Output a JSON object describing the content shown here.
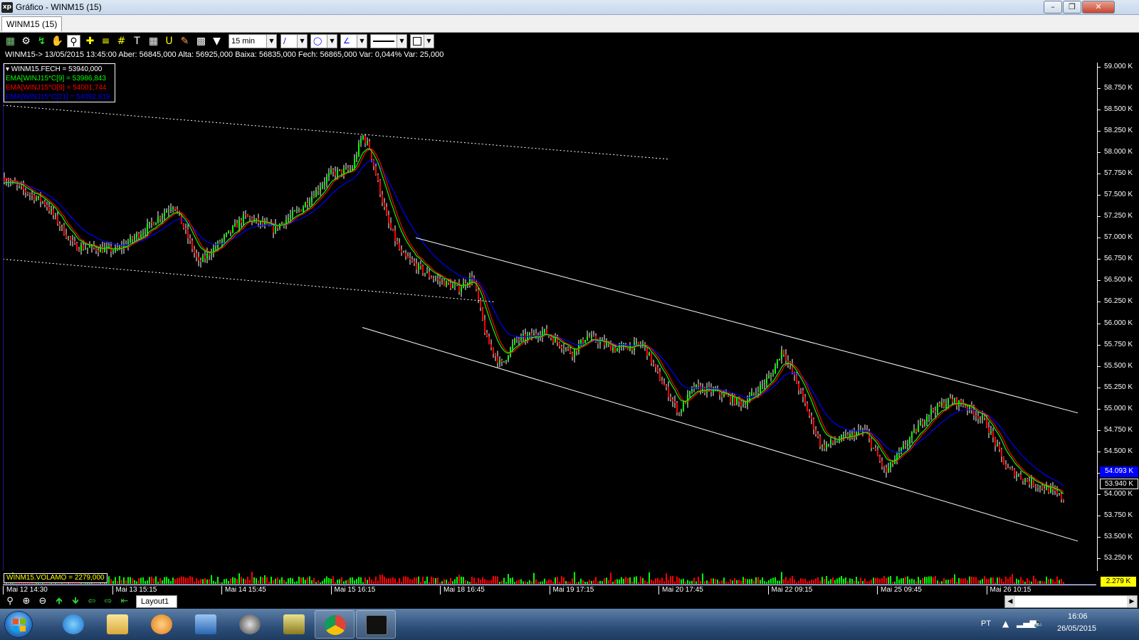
{
  "window": {
    "title": "Gráfico - WINM15 (15)",
    "app_icon_text": "xp",
    "minimize_icon": "minimize-icon",
    "maximize_icon": "maximize-icon",
    "close_icon": "close-icon"
  },
  "tabs": [
    {
      "label": "WINM15 (15)",
      "active": true
    }
  ],
  "toolbar": {
    "timeframe": "15 min",
    "icons": [
      "chart-type-icon",
      "gear-icon",
      "indicator-icon",
      "hand-icon",
      "zoom-area-icon",
      "crosshair-icon",
      "horizontal-line-icon",
      "grid-icon",
      "text-icon",
      "calculator-icon",
      "magnet-icon",
      "pen-icon",
      "save-icon",
      "filter-icon"
    ],
    "line_tool_icon": "trend-line-icon",
    "ellipse_tool_icon": "ellipse-icon",
    "fib_tool_icon": "fibonacci-fan-icon",
    "line_style_icon": "line-style-icon",
    "color_picker_icon": "color-picker-icon"
  },
  "info_line": "WINM15-> 13/05/2015 13:45:00 Aber: 56845,000 Alta: 56925,000 Baixa: 56835,000 Fech: 56865,000 Var: 0,044% Var: 25,000",
  "legend": [
    {
      "text": "WINM15.FECH = 53940,000",
      "color": "#ffffff",
      "marker": "▾ "
    },
    {
      "text": "EMA[WINJ15*C[9] = 53986,843",
      "color": "#00ff00",
      "marker": ""
    },
    {
      "text": "EMA[WINJ15*O[9] = 54001,744",
      "color": "#ff0000",
      "marker": ""
    },
    {
      "text": "EMA[WINJ15*C[21] = 54092,619",
      "color": "#0000ff",
      "marker": ""
    }
  ],
  "price_axis": {
    "ticks": [
      "59.000 K",
      "58.750 K",
      "58.500 K",
      "58.250 K",
      "58.000 K",
      "57.750 K",
      "57.500 K",
      "57.250 K",
      "57.000 K",
      "56.750 K",
      "56.500 K",
      "56.250 K",
      "56.000 K",
      "55.750 K",
      "55.500 K",
      "55.250 K",
      "55.000 K",
      "54.750 K",
      "54.500 K",
      "54.250 K",
      "54.000 K",
      "53.750 K",
      "53.500 K",
      "53.250 K"
    ],
    "last_ema21": "54.093 K",
    "last_close": "53.940 K"
  },
  "volume": {
    "label": "WINM15.VOLAMO = 2279,000",
    "value": "2.279 K"
  },
  "time_axis": [
    "Mai 12 14:30",
    "Mai 13 15:15",
    "Mai 14 15:45",
    "Mai 15 16:15",
    "Mai 18 16:45",
    "Mai 19 17:15",
    "Mai 20 17:45",
    "Mai 22 09:15",
    "Mai 25 09:45",
    "Mai 26 10:15"
  ],
  "bottom_bar": {
    "icons": [
      "zoom-icon",
      "zoom-in-icon",
      "zoom-out-icon",
      "arrow-up-icon",
      "arrow-down-icon",
      "arrow-left-icon",
      "arrow-right-icon",
      "arrow-end-left-icon"
    ],
    "layout_tab": "Layout1",
    "scroll_left_icon": "scroll-left-icon",
    "scroll_right_icon": "scroll-right-icon"
  },
  "taskbar": {
    "start_icon": "windows-start-icon",
    "apps": [
      "internet-explorer-icon",
      "file-explorer-icon",
      "media-player-icon",
      "outlook-icon",
      "hp-icon",
      "transfer-icon",
      "chrome-icon",
      "xp-investimentos-icon"
    ],
    "language": "PT",
    "time": "16:06",
    "date": "26/05/2015",
    "tray_icons": [
      "tray-arrow-icon",
      "network-icon",
      "volume-icon"
    ]
  },
  "colors": {
    "up_candle": "#00ff00",
    "down_candle": "#ff0000",
    "ema_close_9": "#00ff00",
    "ema_open_9": "#ff0000",
    "ema_close_21": "#0000ff",
    "channel_lines": "#ffffff",
    "background": "#000000"
  },
  "chart_data": {
    "type": "candlestick",
    "title": "",
    "ylim": [
      53100,
      59050
    ],
    "y_unit": "points",
    "x_categories": [
      "Mai 12 14:30",
      "Mai 13 15:15",
      "Mai 14 15:45",
      "Mai 15 16:15",
      "Mai 18 16:45",
      "Mai 19 17:15",
      "Mai 20 17:45",
      "Mai 22 09:15",
      "Mai 25 09:45",
      "Mai 26 10:15"
    ],
    "close_path_estimate": [
      [
        0,
        57700
      ],
      [
        60,
        57400
      ],
      [
        100,
        56900
      ],
      [
        160,
        56850
      ],
      [
        200,
        57100
      ],
      [
        240,
        57400
      ],
      [
        275,
        56700
      ],
      [
        300,
        56900
      ],
      [
        340,
        57250
      ],
      [
        380,
        57100
      ],
      [
        420,
        57350
      ],
      [
        460,
        57750
      ],
      [
        490,
        57800
      ],
      [
        505,
        58200
      ],
      [
        515,
        58050
      ],
      [
        540,
        57200
      ],
      [
        560,
        56800
      ],
      [
        600,
        56550
      ],
      [
        640,
        56400
      ],
      [
        660,
        56550
      ],
      [
        680,
        55800
      ],
      [
        700,
        55500
      ],
      [
        720,
        55800
      ],
      [
        760,
        55900
      ],
      [
        800,
        55650
      ],
      [
        820,
        55850
      ],
      [
        860,
        55700
      ],
      [
        900,
        55750
      ],
      [
        920,
        55400
      ],
      [
        950,
        54950
      ],
      [
        970,
        55250
      ],
      [
        1000,
        55200
      ],
      [
        1040,
        55050
      ],
      [
        1080,
        55400
      ],
      [
        1095,
        55700
      ],
      [
        1120,
        55200
      ],
      [
        1150,
        54550
      ],
      [
        1180,
        54650
      ],
      [
        1210,
        54750
      ],
      [
        1240,
        54250
      ],
      [
        1270,
        54600
      ],
      [
        1300,
        54950
      ],
      [
        1330,
        55100
      ],
      [
        1350,
        55050
      ],
      [
        1380,
        54850
      ],
      [
        1410,
        54300
      ],
      [
        1440,
        54150
      ],
      [
        1470,
        54050
      ],
      [
        1490,
        53940
      ]
    ],
    "ema_close_9_last": 53986.843,
    "ema_open_9_last": 54001.744,
    "ema_close_21_last": 54092.619,
    "last_close": 53940,
    "last_bar": {
      "date": "13/05/2015 13:45:00",
      "open": 56845,
      "high": 56925,
      "low": 56835,
      "close": 56865,
      "var_pct": "0,044%",
      "var": 25
    },
    "trendlines": [
      {
        "style": "dotted",
        "from": [
          0,
          58550
        ],
        "to": [
          935,
          57920
        ]
      },
      {
        "style": "dotted",
        "from": [
          0,
          56750
        ],
        "to": [
          690,
          56250
        ]
      },
      {
        "style": "solid",
        "from": [
          580,
          57000
        ],
        "to": [
          1510,
          54950
        ]
      },
      {
        "style": "solid",
        "from": [
          505,
          55950
        ],
        "to": [
          1510,
          53450
        ]
      }
    ],
    "volume_last": 2279
  }
}
